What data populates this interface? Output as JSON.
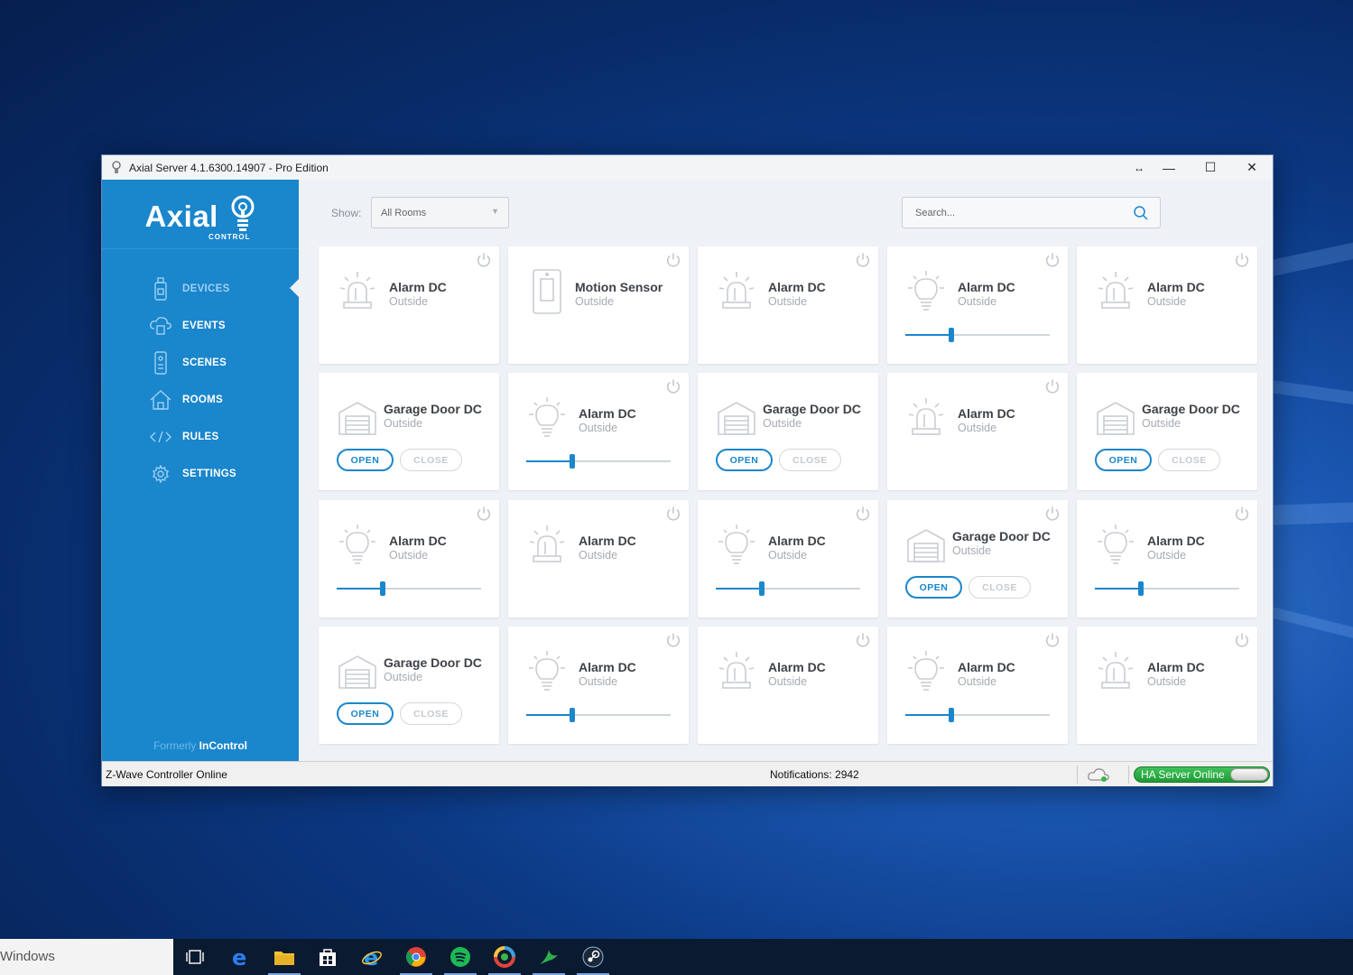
{
  "window": {
    "title": "Axial Server 4.1.6300.14907 - Pro Edition"
  },
  "sidebar": {
    "logo_text": "Axial",
    "logo_sub": "CONTROL",
    "items": [
      {
        "label": "DEVICES",
        "icon": "phone-device-icon",
        "active": true
      },
      {
        "label": "EVENTS",
        "icon": "cloud-events-icon",
        "active": false
      },
      {
        "label": "SCENES",
        "icon": "remote-scenes-icon",
        "active": false
      },
      {
        "label": "ROOMS",
        "icon": "home-icon",
        "active": false
      },
      {
        "label": "RULES",
        "icon": "code-icon",
        "active": false
      },
      {
        "label": "SETTINGS",
        "icon": "gear-icon",
        "active": false
      }
    ],
    "formerly_prefix": "Formerly",
    "formerly_brand": "InControl"
  },
  "toolbar": {
    "show_label": "Show:",
    "room_select_value": "All Rooms",
    "search_placeholder": "Search..."
  },
  "devices": [
    {
      "name": "Alarm DC",
      "location": "Outside",
      "type": "alarm"
    },
    {
      "name": "Motion Sensor",
      "location": "Outside",
      "type": "motion"
    },
    {
      "name": "Alarm DC",
      "location": "Outside",
      "type": "alarm"
    },
    {
      "name": "Alarm DC",
      "location": "Outside",
      "type": "light",
      "level": 0.32
    },
    {
      "name": "Alarm DC",
      "location": "Outside",
      "type": "alarm"
    },
    {
      "name": "Garage Door DC",
      "location": "Outside",
      "type": "garage"
    },
    {
      "name": "Alarm DC",
      "location": "Outside",
      "type": "light",
      "level": 0.32
    },
    {
      "name": "Garage Door DC",
      "location": "Outside",
      "type": "garage"
    },
    {
      "name": "Alarm DC",
      "location": "Outside",
      "type": "alarm"
    },
    {
      "name": "Garage Door DC",
      "location": "Outside",
      "type": "garage"
    },
    {
      "name": "Alarm DC",
      "location": "Outside",
      "type": "light",
      "level": 0.32
    },
    {
      "name": "Alarm DC",
      "location": "Outside",
      "type": "alarm"
    },
    {
      "name": "Alarm DC",
      "location": "Outside",
      "type": "light",
      "level": 0.32
    },
    {
      "name": "Garage Door DC",
      "location": "Outside",
      "type": "garage"
    },
    {
      "name": "Alarm DC",
      "location": "Outside",
      "type": "light",
      "level": 0.32
    },
    {
      "name": "Garage Door DC",
      "location": "Outside",
      "type": "garage"
    },
    {
      "name": "Alarm DC",
      "location": "Outside",
      "type": "light",
      "level": 0.32
    },
    {
      "name": "Alarm DC",
      "location": "Outside",
      "type": "alarm"
    },
    {
      "name": "Alarm DC",
      "location": "Outside",
      "type": "light",
      "level": 0.32
    },
    {
      "name": "Alarm DC",
      "location": "Outside",
      "type": "alarm"
    }
  ],
  "garage_buttons": {
    "open": "OPEN",
    "close": "CLOSE"
  },
  "status": {
    "controller": "Z-Wave Controller Online",
    "notifications": "Notifications: 2942",
    "ha_server": "HA Server Online"
  },
  "taskbar": {
    "search_text": "Windows",
    "apps": [
      "task-view-icon",
      "edge-icon",
      "file-explorer-icon",
      "store-icon",
      "internet-explorer-icon",
      "chrome-icon",
      "spotify-icon",
      "photos-icon",
      "bird-app-icon",
      "steam-icon"
    ]
  },
  "colors": {
    "accent": "#1a86cc",
    "ha_online": "#2cab45"
  }
}
